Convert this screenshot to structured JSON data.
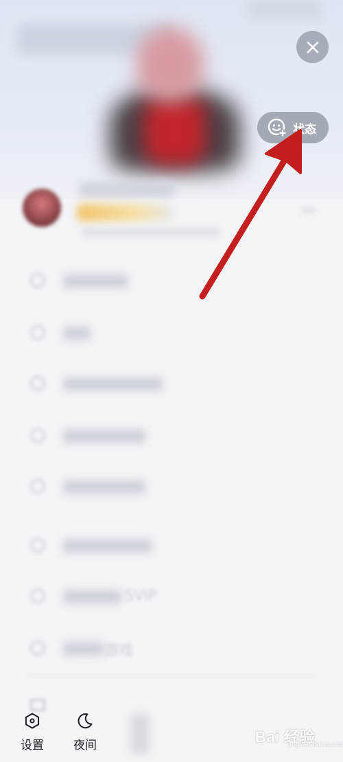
{
  "header": {
    "close_icon": "close-icon",
    "status_button": {
      "label": "状态",
      "icon": "smiley-plus-icon"
    }
  },
  "bottom_bar": {
    "items": [
      {
        "label": "设置",
        "icon": "hexagon-settings-icon"
      },
      {
        "label": "夜间",
        "icon": "moon-icon"
      }
    ]
  },
  "menu": {
    "partial_items": [
      {
        "label": "SVIP"
      },
      {
        "label": "游戏"
      }
    ]
  },
  "watermark": {
    "text": "Bai 经验",
    "sub": "jingyan.baidu.com"
  },
  "colors": {
    "annotation_arrow": "#c41e1e",
    "pill_background": "#a3aab5",
    "page_background": "#f3f5f8"
  }
}
